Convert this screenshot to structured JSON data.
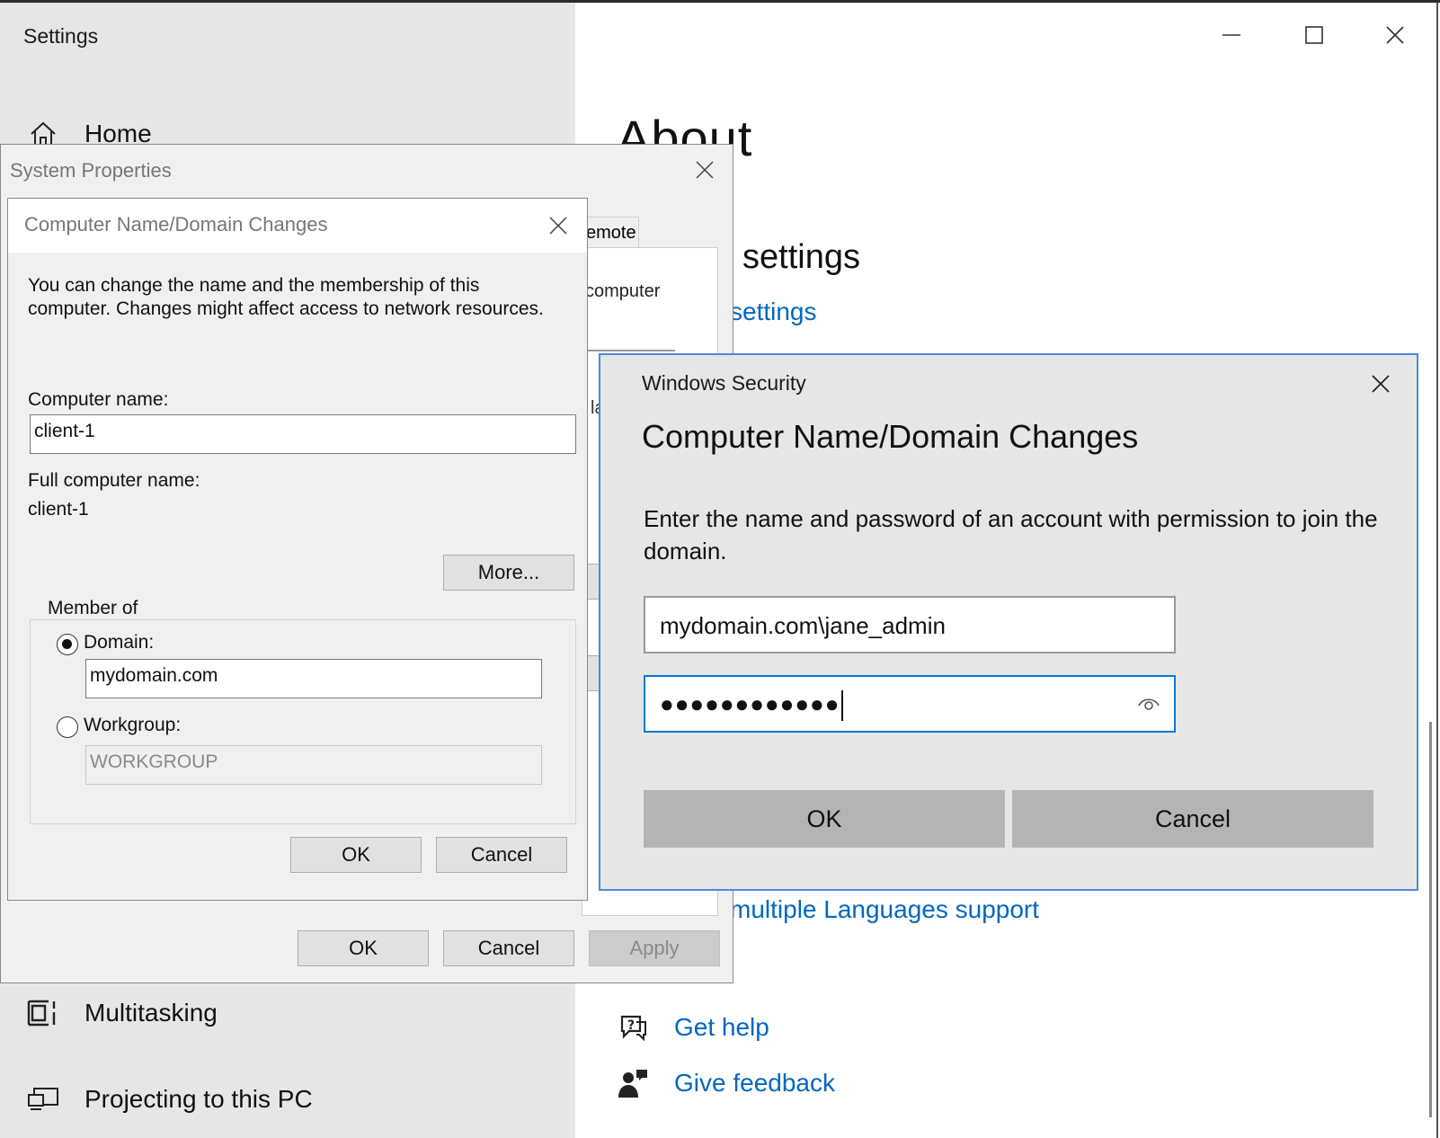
{
  "settings": {
    "title": "Settings",
    "sidebar": {
      "home": "Home",
      "multitasking": "Multitasking",
      "projecting": "Projecting to this PC"
    },
    "main": {
      "title": "About",
      "heading_fragment": "settings",
      "link_fragment": "settings",
      "languages_link": "multiple Languages support",
      "get_help": "Get help",
      "give_feedback": "Give feedback"
    }
  },
  "system_properties": {
    "title": "System Properties",
    "tab_fragment": "emote",
    "panel_text_fragment": "computer",
    "panel_text_fragment2": "la",
    "ok": "OK",
    "cancel": "Cancel",
    "apply": "Apply"
  },
  "computer_name_dialog": {
    "title": "Computer Name/Domain Changes",
    "description": "You can change the name and the membership of this computer. Changes might affect access to network resources.",
    "computer_name_label": "Computer name:",
    "computer_name_value": "client-1",
    "full_name_label": "Full computer name:",
    "full_name_value": "client-1",
    "more_button": "More...",
    "member_of_label": "Member of",
    "domain_label": "Domain:",
    "domain_value": "mydomain.com",
    "domain_selected": true,
    "workgroup_label": "Workgroup:",
    "workgroup_value": "WORKGROUP",
    "ok": "OK",
    "cancel": "Cancel"
  },
  "windows_security": {
    "app_name": "Windows Security",
    "heading": "Computer Name/Domain Changes",
    "message": "Enter the name and password of an account with permission to join the domain.",
    "username_value": "mydomain.com\\jane_admin",
    "password_masked": "●●●●●●●●●●●●",
    "ok": "OK",
    "cancel": "Cancel",
    "accent_color": "#0078d7"
  },
  "colors": {
    "link": "#0067c0",
    "sidebar_bg": "#e6e6e6",
    "dialog_bg": "#f0f0f0"
  }
}
